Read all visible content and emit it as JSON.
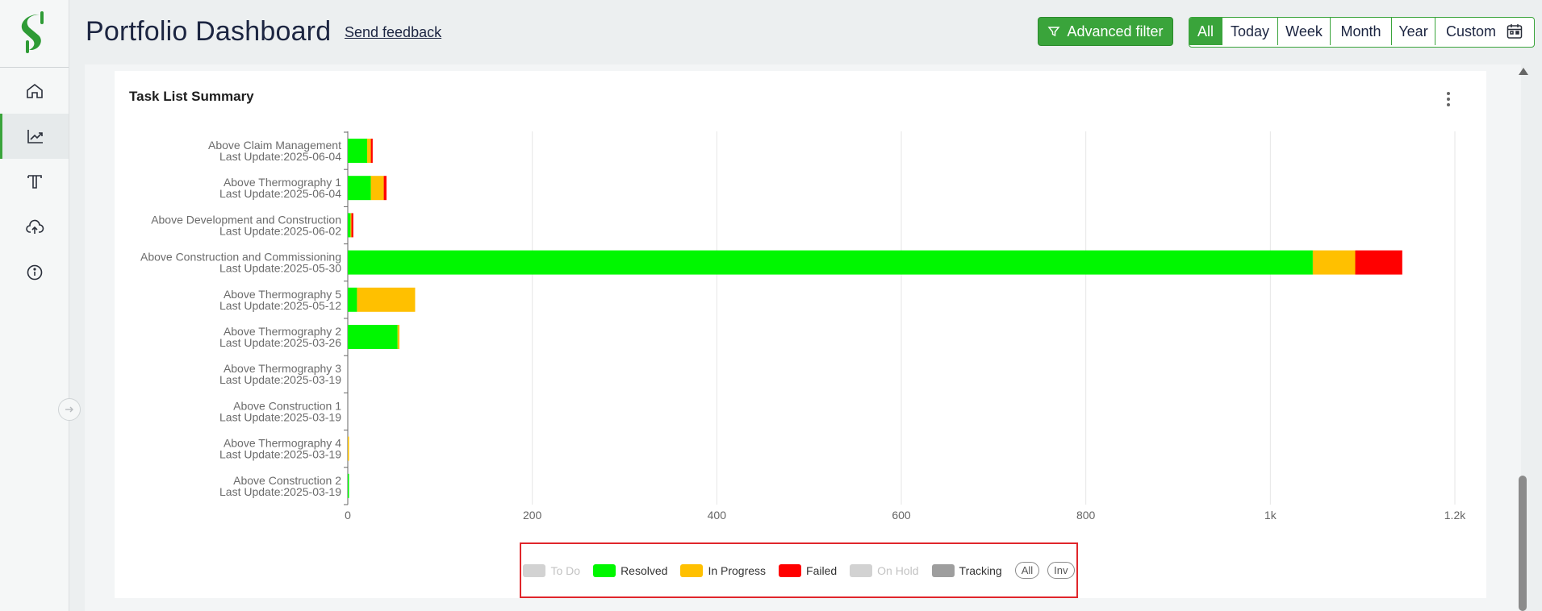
{
  "header": {
    "title": "Portfolio Dashboard",
    "feedback_link": "Send feedback",
    "advanced_filter_label": "Advanced filter",
    "ranges": [
      "All",
      "Today",
      "Week",
      "Month",
      "Year",
      "Custom"
    ],
    "active_range": "All"
  },
  "sidebar": {
    "items": [
      {
        "name": "home",
        "icon": "home-icon"
      },
      {
        "name": "analytics",
        "icon": "chart-trend-icon",
        "active": true
      },
      {
        "name": "text",
        "icon": "text-icon"
      },
      {
        "name": "upload",
        "icon": "cloud-upload-icon"
      },
      {
        "name": "info",
        "icon": "info-icon"
      }
    ]
  },
  "card": {
    "title": "Task List Summary"
  },
  "colors": {
    "todo": "#c8c8c8",
    "resolved": "#00f700",
    "in_progress": "#ffc000",
    "failed": "#ff0000",
    "on_hold": "#c8c8c8",
    "tracking": "#9e9e9e",
    "accent": "#3aa43b"
  },
  "chart_data": {
    "type": "bar",
    "orientation": "horizontal",
    "stacked": true,
    "categories": [
      {
        "name": "Above Claim Management",
        "update": "Last Update:2025-06-04"
      },
      {
        "name": "Above Thermography 1",
        "update": "Last Update:2025-06-04"
      },
      {
        "name": "Above Development and Construction",
        "update": "Last Update:2025-06-02"
      },
      {
        "name": "Above Construction and Commissioning",
        "update": "Last Update:2025-05-30"
      },
      {
        "name": "Above Thermography 5",
        "update": "Last Update:2025-05-12"
      },
      {
        "name": "Above Thermography 2",
        "update": "Last Update:2025-03-26"
      },
      {
        "name": "Above Thermography 3",
        "update": "Last Update:2025-03-19"
      },
      {
        "name": "Above Construction 1",
        "update": "Last Update:2025-03-19"
      },
      {
        "name": "Above Thermography 4",
        "update": "Last Update:2025-03-19"
      },
      {
        "name": "Above Construction 2",
        "update": "Last Update:2025-03-19"
      }
    ],
    "series": [
      {
        "name": "Resolved",
        "key": "resolved",
        "values": [
          21,
          25,
          3,
          1046,
          10,
          54,
          0,
          0,
          0,
          1
        ]
      },
      {
        "name": "In Progress",
        "key": "in_progress",
        "values": [
          4,
          14,
          1,
          46,
          63,
          2,
          0,
          0,
          1,
          0
        ]
      },
      {
        "name": "Failed",
        "key": "failed",
        "values": [
          2,
          3,
          2,
          51,
          0,
          0,
          0,
          0,
          0,
          0
        ]
      }
    ],
    "xlim": [
      0,
      1200
    ],
    "xticks": [
      "0",
      "200",
      "400",
      "600",
      "800",
      "1k",
      "1.2k"
    ],
    "xtick_values": [
      0,
      200,
      400,
      600,
      800,
      1000,
      1200
    ],
    "grid": true,
    "legend_position": "bottom",
    "legend": [
      {
        "label": "To Do",
        "key": "todo",
        "enabled": false
      },
      {
        "label": "Resolved",
        "key": "resolved",
        "enabled": true
      },
      {
        "label": "In Progress",
        "key": "in_progress",
        "enabled": true
      },
      {
        "label": "Failed",
        "key": "failed",
        "enabled": true
      },
      {
        "label": "On Hold",
        "key": "on_hold",
        "enabled": false
      },
      {
        "label": "Tracking",
        "key": "tracking",
        "enabled": true
      }
    ],
    "legend_buttons": [
      "All",
      "Inv"
    ]
  }
}
